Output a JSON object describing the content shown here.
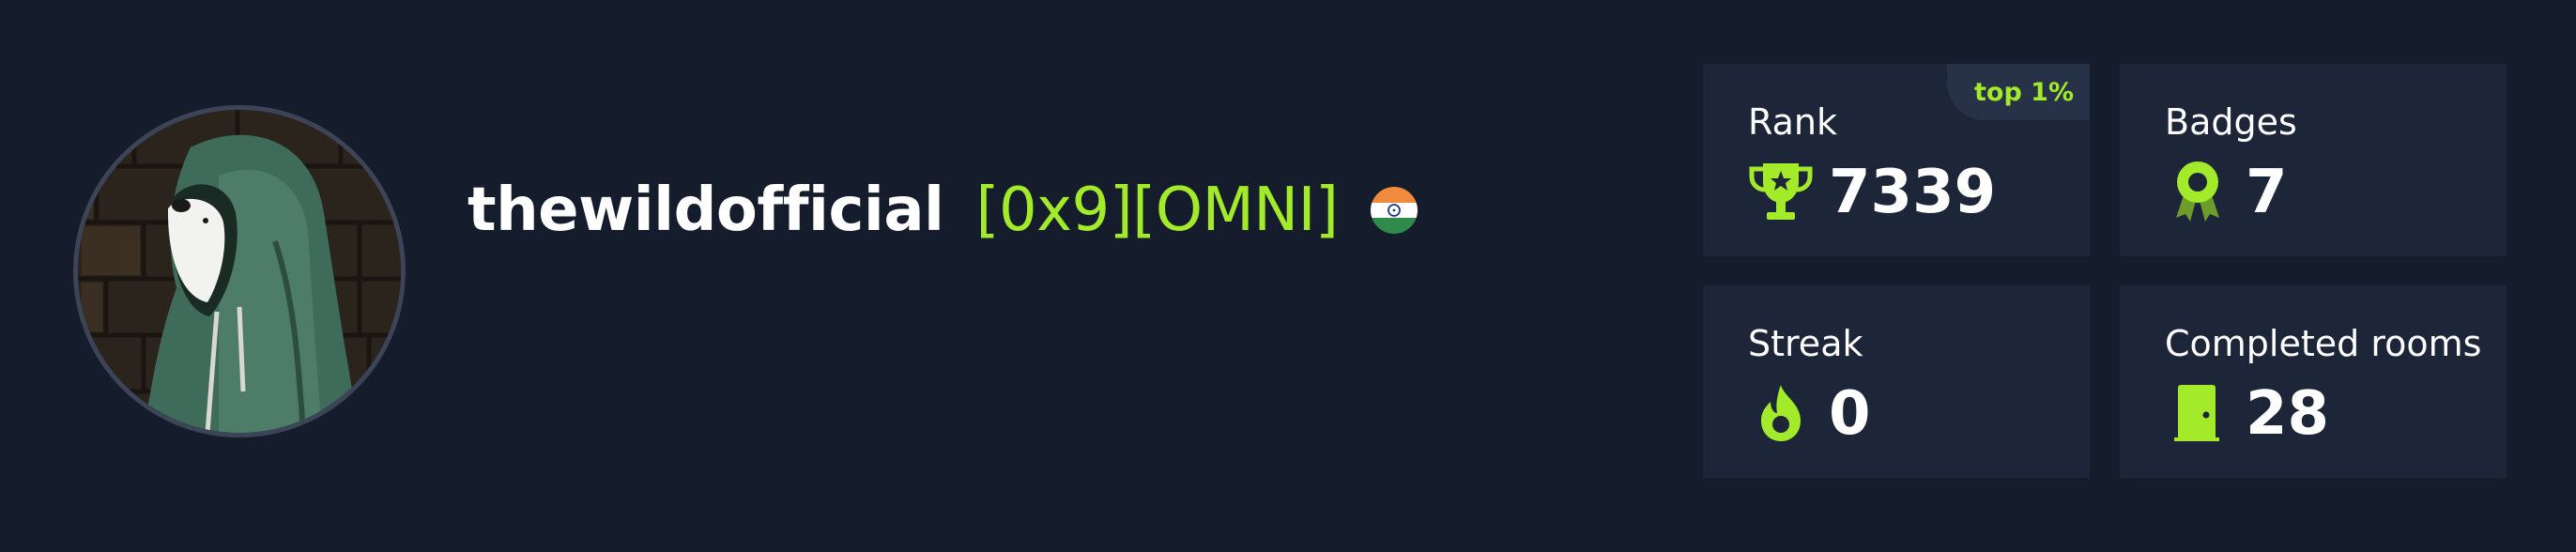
{
  "profile": {
    "username": "thewildofficial",
    "tag": "[0x9][OMNI]",
    "country_flag": "india-flag-icon"
  },
  "stats": {
    "rank": {
      "label": "Rank",
      "value": "7339",
      "badge": "top 1%",
      "icon": "trophy-icon"
    },
    "badges": {
      "label": "Badges",
      "value": "7",
      "icon": "award-ribbon-icon"
    },
    "streak": {
      "label": "Streak",
      "value": "0",
      "icon": "flame-icon"
    },
    "completed_rooms": {
      "label": "Completed rooms",
      "value": "28",
      "icon": "door-icon"
    }
  },
  "colors": {
    "background": "#151c2b",
    "card_background": "#1d2538",
    "accent": "#a3ea2a",
    "text": "#ffffff"
  }
}
